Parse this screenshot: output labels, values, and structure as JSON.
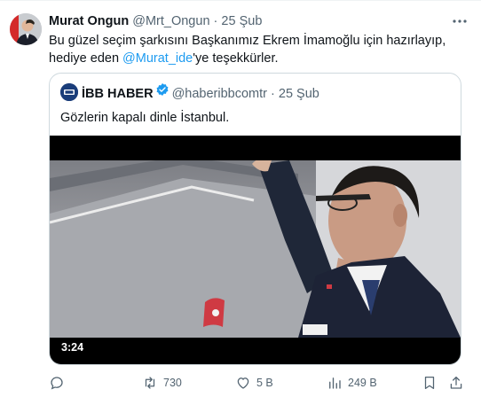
{
  "author": {
    "name": "Murat Ongun",
    "handle": "@Mrt_Ongun",
    "separator": "·",
    "date": "25 Şub",
    "more_icon": "more-icon"
  },
  "tweet": {
    "text_before": "Bu güzel seçim şarkısını Başkanımız Ekrem İmamoğlu için hazırlayıp, hediye eden ",
    "mention": "@Murat_ide",
    "text_after": "'ye teşekkürler."
  },
  "quote": {
    "name": "İBB HABER",
    "handle": "@haberibbcomtr",
    "separator": "·",
    "date": "25 Şub",
    "text": "Gözlerin kapalı dinle İstanbul.",
    "video_duration": "3:24"
  },
  "actions": {
    "reply_count": "",
    "retweet_count": "730",
    "like_count": "5 B",
    "views_count": "249 B"
  },
  "colors": {
    "accent": "#1d9bf0",
    "muted": "#536471",
    "text": "#0f1419",
    "border": "#cfd9de"
  }
}
